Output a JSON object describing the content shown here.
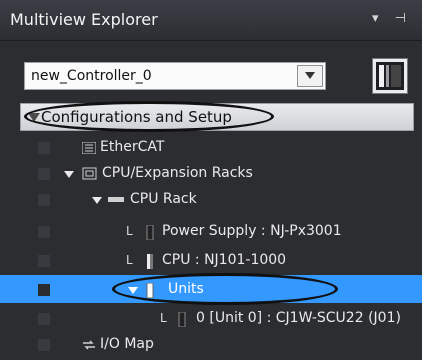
{
  "window": {
    "title": "Multiview Explorer",
    "controls": "▾ ⊣"
  },
  "controller": {
    "selected": "new_Controller_0"
  },
  "tree": {
    "section_label": "Configurations and Setup",
    "items": [
      {
        "label": "EtherCAT"
      },
      {
        "label": "CPU/Expansion Racks"
      },
      {
        "label": "CPU Rack"
      },
      {
        "label": "Power Supply : NJ-Px3001"
      },
      {
        "label": "CPU : NJ101-1000"
      },
      {
        "label": "Units"
      },
      {
        "label": "0 [Unit 0] : CJ1W-SCU22 (J01)"
      },
      {
        "label": "I/O Map"
      }
    ]
  },
  "colors": {
    "background": "#2b2d31",
    "selection": "#3399ff",
    "section_header": "#dcdde0"
  }
}
